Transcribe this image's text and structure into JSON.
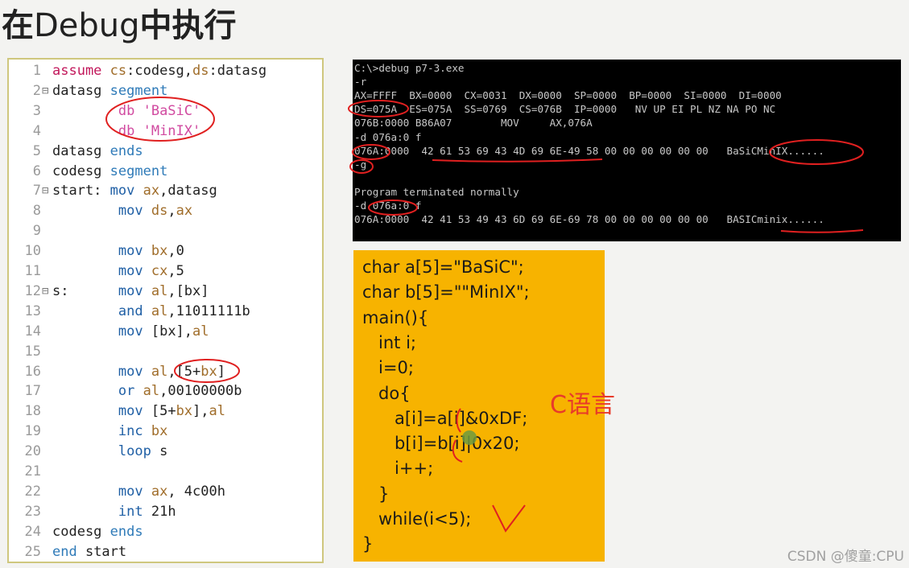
{
  "title": {
    "prefix": "在",
    "latin": "Debug",
    "suffix": "中执行"
  },
  "editor": {
    "lines": [
      {
        "n": "1",
        "fold": "",
        "tokens": [
          [
            "kw",
            "assume "
          ],
          [
            "reg",
            "cs"
          ],
          [
            "pl",
            ":codesg,"
          ],
          [
            "reg",
            "ds"
          ],
          [
            "pl",
            ":datasg"
          ]
        ]
      },
      {
        "n": "2",
        "fold": "⊟",
        "tokens": [
          [
            "pl",
            "datasg "
          ],
          [
            "kw2",
            "segment"
          ]
        ]
      },
      {
        "n": "3",
        "fold": "",
        "tokens": [
          [
            "pl",
            "        "
          ],
          [
            "str",
            "db 'BaSiC'"
          ]
        ]
      },
      {
        "n": "4",
        "fold": "",
        "tokens": [
          [
            "pl",
            "        "
          ],
          [
            "str",
            "db 'MinIX'"
          ]
        ]
      },
      {
        "n": "5",
        "fold": "",
        "tokens": [
          [
            "pl",
            "datasg "
          ],
          [
            "kw2",
            "ends"
          ]
        ]
      },
      {
        "n": "6",
        "fold": "",
        "tokens": [
          [
            "pl",
            "codesg "
          ],
          [
            "kw2",
            "segment"
          ]
        ]
      },
      {
        "n": "7",
        "fold": "⊟",
        "tokens": [
          [
            "pl",
            "start: "
          ],
          [
            "ins",
            "mov "
          ],
          [
            "reg",
            "ax"
          ],
          [
            "pl",
            ",datasg"
          ]
        ]
      },
      {
        "n": "8",
        "fold": "",
        "tokens": [
          [
            "pl",
            "        "
          ],
          [
            "ins",
            "mov "
          ],
          [
            "reg",
            "ds"
          ],
          [
            "pl",
            ","
          ],
          [
            "reg",
            "ax"
          ]
        ]
      },
      {
        "n": "9",
        "fold": "",
        "tokens": []
      },
      {
        "n": "10",
        "fold": "",
        "tokens": [
          [
            "pl",
            "        "
          ],
          [
            "ins",
            "mov "
          ],
          [
            "reg",
            "bx"
          ],
          [
            "pl",
            ",0"
          ]
        ]
      },
      {
        "n": "11",
        "fold": "",
        "tokens": [
          [
            "pl",
            "        "
          ],
          [
            "ins",
            "mov "
          ],
          [
            "reg",
            "cx"
          ],
          [
            "pl",
            ",5"
          ]
        ]
      },
      {
        "n": "12",
        "fold": "⊟",
        "tokens": [
          [
            "pl",
            "s:      "
          ],
          [
            "ins",
            "mov "
          ],
          [
            "reg",
            "al"
          ],
          [
            "pl",
            ",[bx]"
          ]
        ]
      },
      {
        "n": "13",
        "fold": "",
        "tokens": [
          [
            "pl",
            "        "
          ],
          [
            "ins",
            "and "
          ],
          [
            "reg",
            "al"
          ],
          [
            "pl",
            ",11011111b"
          ]
        ]
      },
      {
        "n": "14",
        "fold": "",
        "tokens": [
          [
            "pl",
            "        "
          ],
          [
            "ins",
            "mov "
          ],
          [
            "pl",
            "[bx],"
          ],
          [
            "reg",
            "al"
          ]
        ]
      },
      {
        "n": "15",
        "fold": "",
        "tokens": []
      },
      {
        "n": "16",
        "fold": "",
        "tokens": [
          [
            "pl",
            "        "
          ],
          [
            "ins",
            "mov "
          ],
          [
            "reg",
            "al"
          ],
          [
            "pl",
            ",[5+"
          ],
          [
            "reg",
            "bx"
          ],
          [
            "pl",
            "]"
          ]
        ]
      },
      {
        "n": "17",
        "fold": "",
        "tokens": [
          [
            "pl",
            "        "
          ],
          [
            "ins",
            "or "
          ],
          [
            "reg",
            "al"
          ],
          [
            "pl",
            ",00100000b"
          ]
        ]
      },
      {
        "n": "18",
        "fold": "",
        "tokens": [
          [
            "pl",
            "        "
          ],
          [
            "ins",
            "mov "
          ],
          [
            "pl",
            "[5+"
          ],
          [
            "reg",
            "bx"
          ],
          [
            "pl",
            "],"
          ],
          [
            "reg",
            "al"
          ]
        ]
      },
      {
        "n": "19",
        "fold": "",
        "tokens": [
          [
            "pl",
            "        "
          ],
          [
            "ins",
            "inc "
          ],
          [
            "reg",
            "bx"
          ]
        ]
      },
      {
        "n": "20",
        "fold": "",
        "tokens": [
          [
            "pl",
            "        "
          ],
          [
            "ins",
            "loop "
          ],
          [
            "pl",
            "s"
          ]
        ]
      },
      {
        "n": "21",
        "fold": "",
        "tokens": []
      },
      {
        "n": "22",
        "fold": "",
        "tokens": [
          [
            "pl",
            "        "
          ],
          [
            "ins",
            "mov "
          ],
          [
            "reg",
            "ax"
          ],
          [
            "pl",
            ", 4c00h"
          ]
        ]
      },
      {
        "n": "23",
        "fold": "",
        "tokens": [
          [
            "pl",
            "        "
          ],
          [
            "ins",
            "int "
          ],
          [
            "pl",
            "21h"
          ]
        ]
      },
      {
        "n": "24",
        "fold": "",
        "tokens": [
          [
            "pl",
            "codesg "
          ],
          [
            "kw2",
            "ends"
          ]
        ]
      },
      {
        "n": "25",
        "fold": "",
        "tokens": [
          [
            "kw2",
            "end "
          ],
          [
            "pl",
            "start"
          ]
        ]
      }
    ]
  },
  "console": {
    "lines": [
      "C:\\>debug p7-3.exe",
      "-r",
      "AX=FFFF  BX=0000  CX=0031  DX=0000  SP=0000  BP=0000  SI=0000  DI=0000",
      "DS=075A  ES=075A  SS=0769  CS=076B  IP=0000   NV UP EI PL NZ NA PO NC",
      "076B:0000 B86A07        MOV     AX,076A",
      "-d 076a:0 f",
      "076A:0000  42 61 53 69 43 4D 69 6E-49 58 00 00 00 00 00 00   BaSiCMinIX......",
      "-g",
      "",
      "Program terminated normally",
      "-d 076a:0 f",
      "076A:0000  42 41 53 49 43 6D 69 6E-69 78 00 00 00 00 00 00   BASICminix......"
    ]
  },
  "c_code": {
    "lines": [
      "char a[5]=\"BaSiC\";",
      "char b[5]=\"\"MinIX\";",
      "main(){",
      "   int i;",
      "   i=0;",
      "   do{",
      "      a[i]=a[i]&0xDF;",
      "      b[i]=b[i]|0x20;",
      "      i++;",
      "   }",
      "   while(i<5);",
      "}"
    ],
    "label": "C语言"
  },
  "watermark": "CSDN @傻童:CPU",
  "colors": {
    "annotation": "#e02020",
    "panel": "#f7b300",
    "console_bg": "#000000"
  }
}
